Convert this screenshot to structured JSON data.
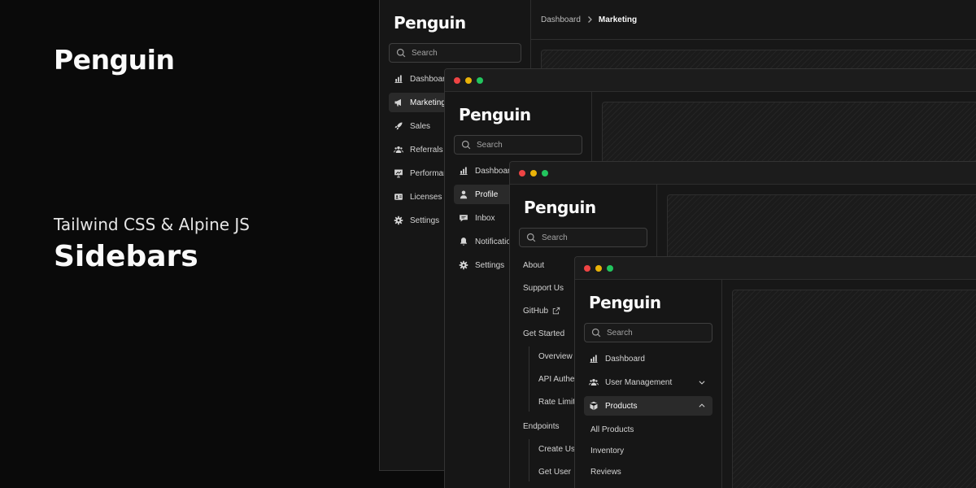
{
  "hero": {
    "logo": "Penguin",
    "subtitle": "Tailwind CSS & Alpine JS",
    "title": "Sidebars"
  },
  "window1": {
    "logo": "Penguin",
    "search_placeholder": "Search",
    "breadcrumb": [
      "Dashboard",
      "Marketing"
    ],
    "nav": [
      {
        "label": "Dashboard",
        "icon": "chart-bar-icon"
      },
      {
        "label": "Marketing",
        "icon": "megaphone-icon",
        "active": true
      },
      {
        "label": "Sales",
        "icon": "rocket-icon"
      },
      {
        "label": "Referrals",
        "icon": "users-icon"
      },
      {
        "label": "Performance",
        "icon": "presentation-chart-icon"
      },
      {
        "label": "Licenses",
        "icon": "id-card-icon"
      },
      {
        "label": "Settings",
        "icon": "gear-icon"
      }
    ]
  },
  "window2": {
    "logo": "Penguin",
    "search_placeholder": "Search",
    "nav": [
      {
        "label": "Dashboard",
        "icon": "chart-bar-icon"
      },
      {
        "label": "Profile",
        "icon": "user-icon",
        "active": true
      },
      {
        "label": "Inbox",
        "icon": "chat-bubble-icon"
      },
      {
        "label": "Notifications",
        "icon": "bell-icon"
      },
      {
        "label": "Settings",
        "icon": "gear-icon"
      }
    ]
  },
  "window3": {
    "logo": "Penguin",
    "search_placeholder": "Search",
    "nav": [
      "About",
      "Support Us",
      "GitHub",
      "Get Started"
    ],
    "get_started_sub": [
      "Overview",
      "API Authentication",
      "Rate Limiting"
    ],
    "endpoints_label": "Endpoints",
    "endpoints_sub": [
      "Create User",
      "Get User"
    ]
  },
  "window4": {
    "logo": "Penguin",
    "search_placeholder": "Search",
    "nav": [
      {
        "label": "Dashboard",
        "icon": "chart-bar-icon"
      },
      {
        "label": "User Management",
        "icon": "users-icon",
        "chevron": "chevron-down-icon"
      },
      {
        "label": "Products",
        "icon": "cube-icon",
        "chevron": "chevron-up-icon",
        "active": true
      }
    ],
    "products_sub": [
      "All Products",
      "Inventory",
      "Reviews"
    ]
  },
  "colors": {
    "bg": "#0a0a0a",
    "panel": "#171717",
    "active": "#2a2a2a",
    "red": "#ef4444",
    "yellow": "#eab308",
    "green": "#22c55e"
  }
}
